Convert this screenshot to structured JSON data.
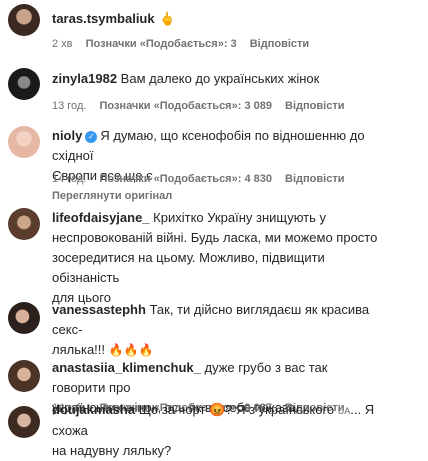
{
  "comments": [
    {
      "username": "taras.tsymbaliuk",
      "emoji": "🖕",
      "time": "2 хв",
      "likes": "Позначки «Подобається»: 3",
      "reply": "Відповісти"
    },
    {
      "username": "zinyla1982",
      "text": "Вам далеко до українських жінок",
      "time": "13 год.",
      "likes": "Позначки «Подобається»: 3 089",
      "reply": "Відповісти"
    },
    {
      "username": "nioly",
      "text_line1": "Я думаю, що ксенофобія по відношенню до східної",
      "text_line2": "Європи все ще є",
      "time": "14 год.",
      "likes": "Позначки «Подобається»: 4 830",
      "reply": "Відповісти",
      "see_original": "Переглянути оригінал"
    },
    {
      "username": "lifeofdaisyjane_",
      "text_line1": "Крихітко Україну знищують у",
      "text_line2": "неспровокованій війні. Будь ласка, ми можемо просто",
      "text_line3": "зосередитися на цьому. Можливо, підвищити обізнаність",
      "text_line4": "для цього"
    },
    {
      "username": "vanessastephh",
      "text_line1": "Так, ти дійсно виглядаєш як красива секс-",
      "text_line2": "лялька!!!",
      "emoji": "🔥🔥🔥"
    },
    {
      "username": "anastasiia_klimenchuk_",
      "text_line1": "дуже грубо з вас так говорити про",
      "text_line2": "українських жінок, ось як ви себе показали",
      "time": "14 год.",
      "likes": "Позначки «Подобається»: 9 087",
      "reply": "Відповісти"
    },
    {
      "username": "doujakmasha",
      "text_a": "Що за чорт",
      "emoji_a": "😡",
      "text_b": "? Я з українського",
      "flag": "UA",
      "text_c": "... Я схожа",
      "text_line2": "на надувну ляльку?"
    }
  ]
}
